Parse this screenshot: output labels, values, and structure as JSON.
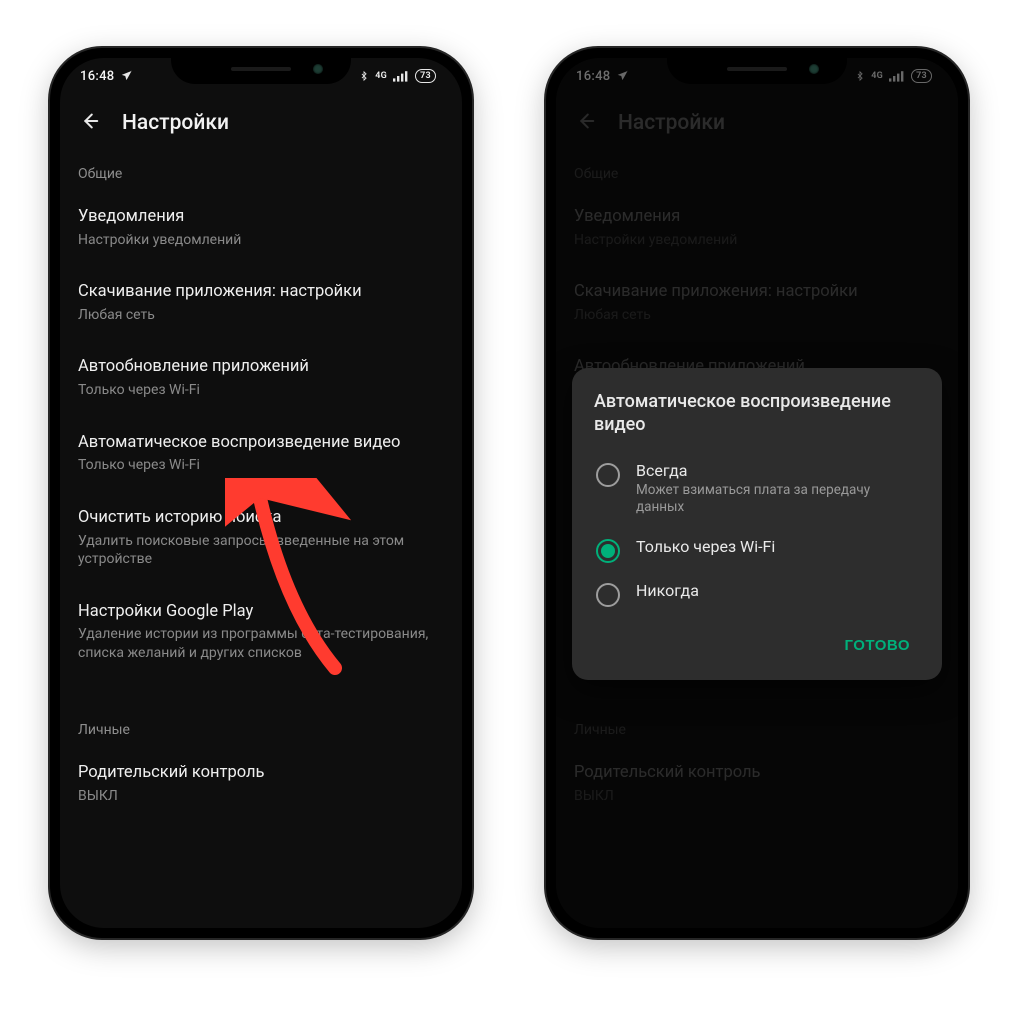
{
  "status": {
    "time": "16:48",
    "battery": "73",
    "network_label": "4G"
  },
  "header": {
    "title": "Настройки"
  },
  "sections": {
    "general_label": "Общие",
    "personal_label": "Личные"
  },
  "items": {
    "notifications": {
      "title": "Уведомления",
      "sub": "Настройки уведомлений"
    },
    "download": {
      "title": "Скачивание приложения: настройки",
      "sub": "Любая сеть"
    },
    "autoupdate": {
      "title": "Автообновление приложений",
      "sub": "Только через Wi-Fi"
    },
    "autoplay": {
      "title": "Автоматическое воспроизведение видео",
      "sub": "Только через Wi-Fi"
    },
    "clearhistory": {
      "title": "Очистить историю поиска",
      "sub": "Удалить поисковые запросы, введенные на этом устройстве"
    },
    "playsettings": {
      "title": "Настройки Google Play",
      "sub": "Удаление истории из программы бета-тестирования, списка желаний и других списков"
    },
    "parental": {
      "title": "Родительский контроль",
      "sub": "ВЫКЛ"
    }
  },
  "dialog": {
    "title": "Автоматическое воспроизведение видео",
    "opt_always": {
      "label": "Всегда",
      "hint": "Может взиматься плата за передачу данных"
    },
    "opt_wifi": {
      "label": "Только через Wi-Fi"
    },
    "opt_never": {
      "label": "Никогда"
    },
    "done": "ГОТОВО"
  },
  "colors": {
    "accent": "#00b07a",
    "arrow": "#ff3b2f"
  }
}
